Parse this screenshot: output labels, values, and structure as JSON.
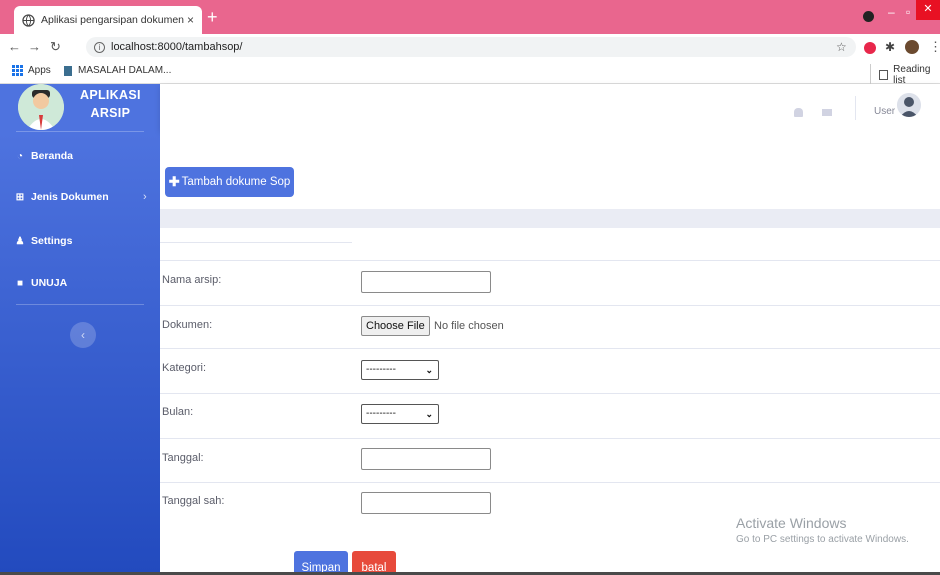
{
  "browser": {
    "tab_title": "Aplikasi pengarsipan dokumen",
    "tab_close": "×",
    "new_tab": "+",
    "url": "localhost:8000/tambahsop/",
    "bookmarks": [
      "Apps",
      "MASALAH DALAM..."
    ],
    "reading_list": "Reading list"
  },
  "sidebar": {
    "brand_line1": "APLIKASI",
    "brand_line2": "ARSIP",
    "items": [
      {
        "label": "Beranda",
        "icon": "tachometer-icon"
      },
      {
        "label": "Jenis Dokumen",
        "icon": "table-icon"
      },
      {
        "label": "Settings",
        "icon": "user-icon"
      },
      {
        "label": "UNUJA",
        "icon": "folder-icon"
      }
    ],
    "toggle": "‹"
  },
  "topbar": {
    "user_label": "User"
  },
  "main": {
    "add_button": "Tambah dokume Sop",
    "fields": [
      {
        "label": "Nama arsip:",
        "type": "text",
        "value": ""
      },
      {
        "label": "Dokumen:",
        "type": "file",
        "button": "Choose File",
        "status": "No file chosen"
      },
      {
        "label": "Kategori:",
        "type": "select",
        "selected": "---------"
      },
      {
        "label": "Bulan:",
        "type": "select",
        "selected": "---------"
      },
      {
        "label": "Tanggal:",
        "type": "text",
        "value": ""
      },
      {
        "label": "Tanggal sah:",
        "type": "text",
        "value": ""
      }
    ],
    "save_button": "Simpan",
    "cancel_button": "batal"
  },
  "watermark": {
    "line1": "Activate Windows",
    "line2": "Go to PC settings to activate Windows."
  },
  "colors": {
    "primary": "#4e73df",
    "danger": "#e74a3b",
    "tabbar": "#e9668e"
  }
}
